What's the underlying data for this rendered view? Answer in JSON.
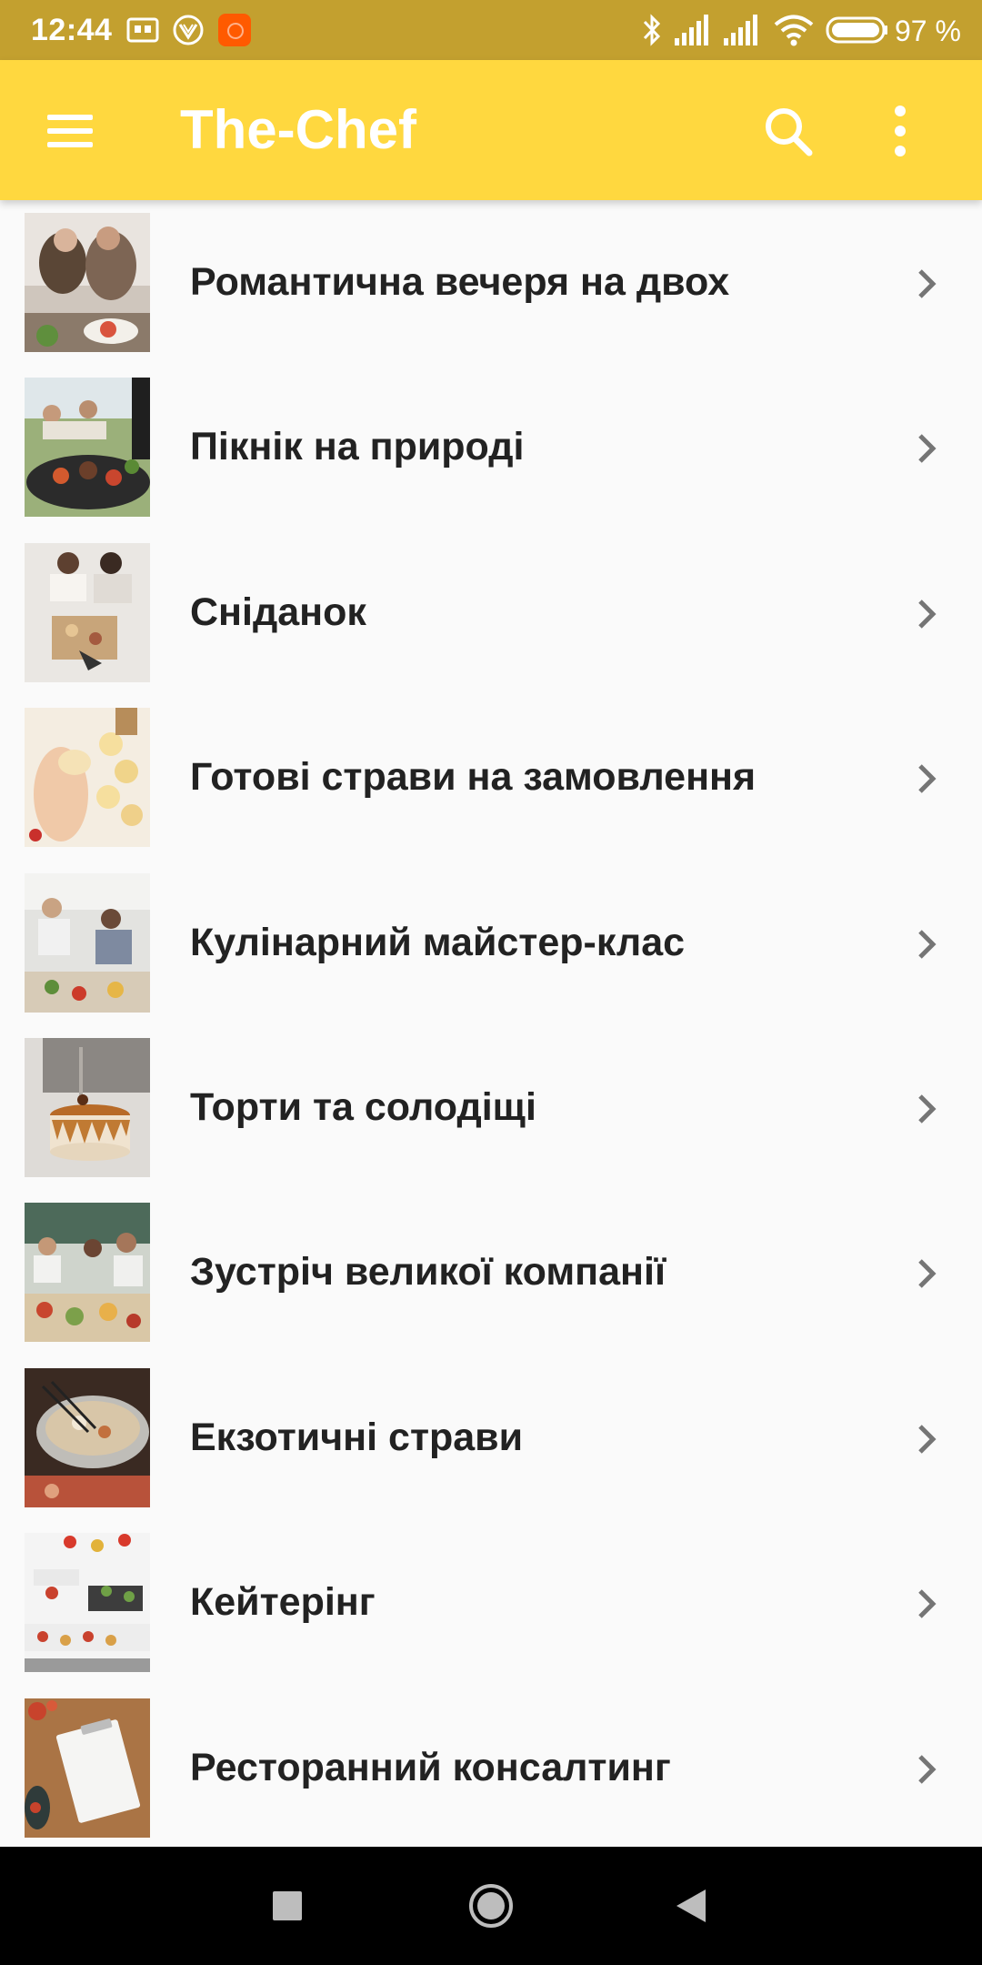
{
  "status_bar": {
    "time": "12:44",
    "battery_percent": "97 %",
    "left_icons": [
      "screen-recorder-icon",
      "vpn-icon",
      "app-notification-icon"
    ],
    "right_icons": [
      "bluetooth-icon",
      "signal-icon",
      "signal-icon",
      "wifi-icon",
      "battery-icon"
    ],
    "color": "#c3a02f"
  },
  "app_bar": {
    "title": "The-Chef",
    "color": "#ffd83f",
    "menu_icon": "hamburger-menu-icon",
    "search_icon": "search-icon",
    "overflow_icon": "more-vertical-icon"
  },
  "categories": [
    {
      "label": "Романтична вечеря на двох"
    },
    {
      "label": "Пікнік на природі"
    },
    {
      "label": "Сніданок"
    },
    {
      "label": "Готові страви на замовлення"
    },
    {
      "label": "Кулінарний майстер-клас"
    },
    {
      "label": "Торти та солодіщі"
    },
    {
      "label": "Зустріч великої компанії"
    },
    {
      "label": "Екзотичні страви"
    },
    {
      "label": "Кейтерінг"
    },
    {
      "label": "Ресторанний консалтинг"
    }
  ],
  "nav_bar": {
    "buttons": [
      "recents-icon",
      "home-icon",
      "back-icon"
    ]
  }
}
